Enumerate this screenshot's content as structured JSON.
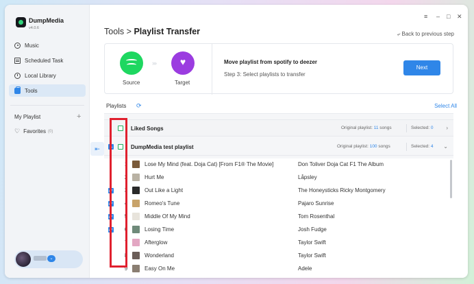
{
  "app": {
    "name": "DumpMedia",
    "version": "v4.0.6"
  },
  "sidebar": {
    "items": [
      {
        "label": "Music",
        "icon": "music-icon"
      },
      {
        "label": "Scheduled Task",
        "icon": "calendar-icon"
      },
      {
        "label": "Local Library",
        "icon": "folder-icon"
      },
      {
        "label": "Tools",
        "icon": "toolbox-icon",
        "active": true
      }
    ],
    "my_playlist": "My Playlist",
    "favorites": "Favorites",
    "favorites_count": "(0)"
  },
  "header": {
    "breadcrumb_root": "Tools",
    "breadcrumb_sep": ">",
    "breadcrumb_current": "Playlist Transfer",
    "back_link": "Back to previous step",
    "window_controls": [
      "menu",
      "minimize",
      "maximize",
      "close"
    ]
  },
  "transfer": {
    "source_label": "Source",
    "target_label": "Target",
    "title": "Move playlist from spotify to deezer",
    "step": "Step 3: Select playlists to transfer",
    "next_button": "Next"
  },
  "playlists": {
    "header": "Playlists",
    "select_all": "Select All",
    "groups": [
      {
        "name": "Liked Songs",
        "original_label": "Original playlist:",
        "original_count": "11",
        "songs_label": "songs",
        "selected_label": "Selected:",
        "selected_count": "0",
        "chevron": "›"
      },
      {
        "name": "DumpMedia test playlist",
        "original_label": "Original playlist:",
        "original_count": "100",
        "songs_label": "songs",
        "selected_label": "Selected:",
        "selected_count": "4",
        "chevron": "⌄"
      }
    ],
    "songs": [
      {
        "num": "1",
        "title": "Lose My Mind (feat. Doja Cat) [From F1® The Movie]",
        "artist": "Don Toliver Doja Cat F1 The Album",
        "checked": false,
        "thumb": "#7a5a3a"
      },
      {
        "num": "2",
        "title": "Hurt Me",
        "artist": "Låpsley",
        "checked": false,
        "thumb": "#b9b2a4"
      },
      {
        "num": "3",
        "title": "Out Like a Light",
        "artist": "The Honeysticks Ricky Montgomery",
        "checked": true,
        "thumb": "#2a2a2a"
      },
      {
        "num": "4",
        "title": "Romeo's Tune",
        "artist": "Pajaro Sunrise",
        "checked": true,
        "thumb": "#c8a36a"
      },
      {
        "num": "5",
        "title": "Middle Of My Mind",
        "artist": "Tom Rosenthal",
        "checked": true,
        "thumb": "#e8e4dc"
      },
      {
        "num": "6",
        "title": "Losing Time",
        "artist": "Josh Fudge",
        "checked": true,
        "thumb": "#6f8a7a"
      },
      {
        "num": "7",
        "title": "Afterglow",
        "artist": "Taylor Swift",
        "checked": false,
        "thumb": "#e3a7c3"
      },
      {
        "num": "8",
        "title": "Wonderland",
        "artist": "Taylor Swift",
        "checked": false,
        "thumb": "#6b5e58"
      },
      {
        "num": "9",
        "title": "Easy On Me",
        "artist": "Adele",
        "checked": false,
        "thumb": "#8a7e72"
      }
    ]
  },
  "colors": {
    "accent": "#2f86e8",
    "spotify": "#1ed760",
    "deezer": "#9b3ce0",
    "highlight": "#e0202e"
  }
}
